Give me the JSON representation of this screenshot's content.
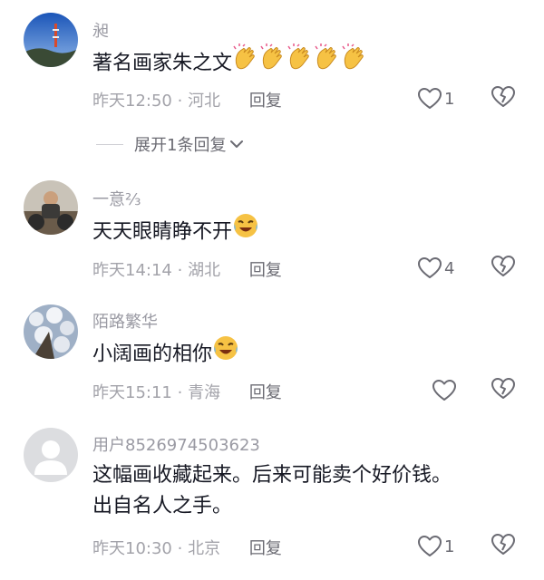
{
  "comments": [
    {
      "username": "昶",
      "text": "著名画家朱之文",
      "emoji_name": "clap-emoji",
      "emoji_count": 5,
      "time": "昨天12:50",
      "location": "河北",
      "reply_label": "回复",
      "like_count": "1"
    },
    {
      "username": "一意⅔",
      "text": "天天眼睛睁不开",
      "emoji_name": "laugh-cry-emoji",
      "emoji_count": 1,
      "time": "昨天14:14",
      "location": "湖北",
      "reply_label": "回复",
      "like_count": "4"
    },
    {
      "username": "陌路繁华",
      "text": "小阔画的相你",
      "emoji_name": "laugh-cry-emoji",
      "emoji_count": 1,
      "time": "昨天15:11",
      "location": "青海",
      "reply_label": "回复",
      "like_count": ""
    },
    {
      "username": "用户8526974503623",
      "text_line1": "这幅画收藏起来。后来可能卖个好价钱。",
      "text_line2": "出自名人之手。",
      "time": "昨天10:30",
      "location": "北京",
      "reply_label": "回复",
      "like_count": "1"
    }
  ],
  "expand_replies": {
    "label": "展开1条回复"
  },
  "meta_separator": "·",
  "colors": {
    "primary_text": "#161823",
    "secondary_text": "#a3a3aa",
    "emoji_yellow": "#f6c244"
  }
}
